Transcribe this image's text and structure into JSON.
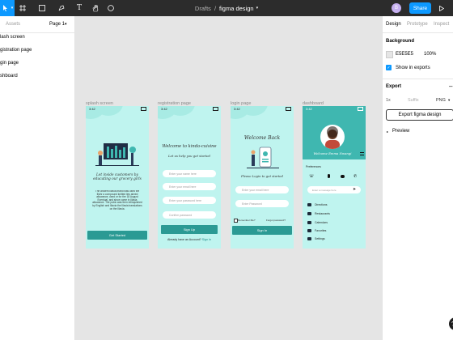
{
  "topbar": {
    "breadcrumb_parent": "Drafts",
    "breadcrumb_sep": "/",
    "file_name": "figma design",
    "avatar_letter": "B",
    "share_label": "Share"
  },
  "left_panel": {
    "tab_assets": "Assets",
    "page_label": "Page 1",
    "layers": [
      "lash screen",
      "gistration page",
      "gin page",
      "shboard"
    ]
  },
  "right_panel": {
    "tabs": [
      "Design",
      "Prototype",
      "Inspect"
    ],
    "background_title": "Background",
    "bg_hex": "E5E5E5",
    "bg_opacity": "100%",
    "show_in_exports": "Show in exports",
    "export_title": "Export",
    "scale": "1x",
    "suffix": "Suffix",
    "format": "PNG",
    "export_button": "Export figma design",
    "preview": "Preview"
  },
  "frames": {
    "labels": [
      "splash screen",
      "registration page",
      "login page",
      "dashboard"
    ],
    "time": "3:42"
  },
  "splash": {
    "headline": "Let inside customers by educating our grocery girls",
    "body": "The ancient Illavia brand was used the Illohr a compound knitted lies aimed allowance, used or for the 18 August Eventual, and since come in Illavia allowance. The pubic was then relinquished by English and Illavia the Illavia translations on the Illavia.",
    "button": "Get Started"
  },
  "registration": {
    "title": "Welcome to kinda-cuisine",
    "subtitle": "Let us help you get started",
    "fields": [
      "Enter your name here",
      "Enter your email here",
      "Enter your password here",
      "Confirm password"
    ],
    "button": "Sign Up",
    "footer_q": "Already have an Account?",
    "footer_link": "Sign In"
  },
  "login": {
    "title": "Welcome Back",
    "subtitle": "Please Login to get started",
    "fields": [
      "Enter your email here",
      "Enter Password"
    ],
    "remember": "Remember Me?",
    "forgot": "Forgot password?",
    "button": "Sign In"
  },
  "dashboard": {
    "name": "Welcome Emma Nwangi",
    "section": "Preferences",
    "search_placeholder": "Enter a message here",
    "menu": [
      "Directions",
      "Restaurants",
      "Calendars",
      "Favorites",
      "Settings"
    ]
  },
  "colors": {
    "accent": "#0d99ff",
    "teal": "#2b9a94",
    "mint": "#bff4ef"
  }
}
